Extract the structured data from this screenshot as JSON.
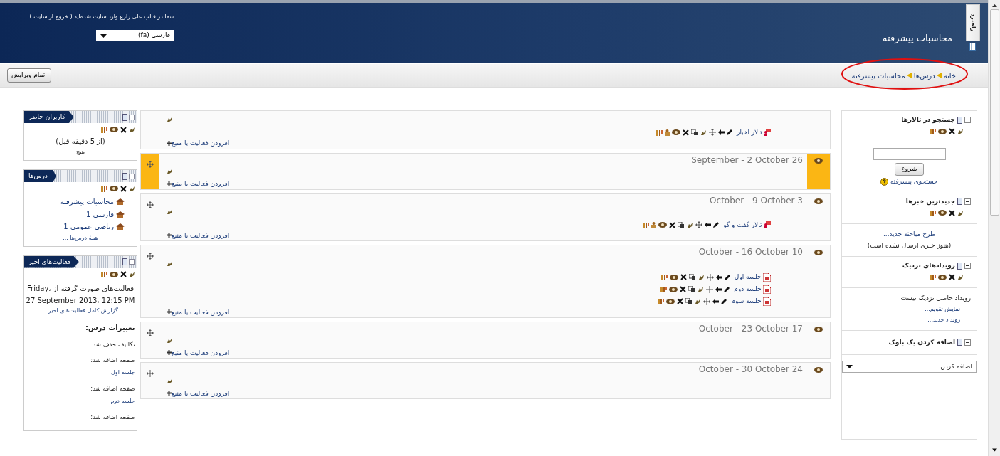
{
  "header": {
    "course_title": "محاسبات پیشرفته",
    "login_info": {
      "before": "شما در قالب",
      "user": "علی زارع",
      "middle": "وارد سایت شده‌اید (",
      "logout": "خروج از سایت",
      "after": ")"
    },
    "language": "فارسی (fa)",
    "side_tab": "راهبرد"
  },
  "navbar": {
    "breadcrumb": [
      "خانه",
      "درس‌ها",
      "محاسبات پیشرفته"
    ],
    "edit_button": "اتمام ویرایش"
  },
  "right_blocks": [
    {
      "kind": "search",
      "title": "جستجو در تالارها",
      "button": "شروع",
      "link": "جستجوی پیشرفته"
    },
    {
      "kind": "news",
      "title": "جدیدترین خبرها",
      "link": "طرح مباحثه جدید...",
      "note": "(هنوز خبری ارسال نشده است)"
    },
    {
      "kind": "events",
      "title": "رویدادهای نزدیک",
      "note": "رویداد خاصی نزدیک نیست",
      "links": [
        "نمایش تقویم...",
        "رویداد جدید..."
      ]
    },
    {
      "kind": "addblock",
      "title": "اضافه کردن یک بلوک",
      "select": "اضافه کردن..."
    }
  ],
  "sections": [
    {
      "highlighted": false,
      "activities": [
        {
          "kind": "forum",
          "name": "تالار اخبار"
        }
      ],
      "add_link": "افزودن فعالیت یا منبع"
    },
    {
      "title": "September - 2 October 26",
      "highlighted": true,
      "add_link": "افزودن فعالیت یا منبع"
    },
    {
      "title": "October - 9 October 3",
      "highlighted": false,
      "activities": [
        {
          "kind": "forum",
          "name": "تالار گفت و گو"
        }
      ],
      "add_link": "افزودن فعالیت یا منبع"
    },
    {
      "title": "October - 16 October 10",
      "highlighted": false,
      "activities": [
        {
          "kind": "resource",
          "name": "جلسه اول"
        },
        {
          "kind": "resource",
          "name": "جلسه دوم"
        },
        {
          "kind": "resource",
          "name": "جلسه سوم"
        }
      ],
      "add_link": "افزودن فعالیت یا منبع"
    },
    {
      "title": "October - 23 October 17",
      "highlighted": false,
      "add_link": "افزودن فعالیت یا منبع"
    },
    {
      "title": "October - 30 October 24",
      "highlighted": false,
      "add_link": "افزودن فعالیت یا منبع"
    }
  ],
  "left_blocks": [
    {
      "kind": "online",
      "title": "کاربران حاضر",
      "note": "(از 5 دقیقه قبل)",
      "value": "هیچ"
    },
    {
      "kind": "courses",
      "title": "درس‌ها",
      "courses": [
        "محاسبات پیشرفته",
        "فارسی 1",
        "ریاضی عمومی 1"
      ],
      "link": "همهٔ درس‌ها ..."
    },
    {
      "kind": "recent",
      "title": "فعالیت‌های اخیر",
      "since": "فعالیت‌های صورت گرفته از Friday، 27 September 2013، 12:15 PM",
      "link": "گزارش کامل فعالیت‌های اخیر...",
      "heading": "تغییرات درس:",
      "items": [
        {
          "label": "تکالیف حذف شد"
        },
        {
          "label": "صفحه اضافه شد:",
          "link": "جلسه اول"
        },
        {
          "label": "صفحه اضافه شد:",
          "link": "جلسه دوم"
        },
        {
          "label": "صفحه اضافه شد:"
        }
      ]
    }
  ]
}
